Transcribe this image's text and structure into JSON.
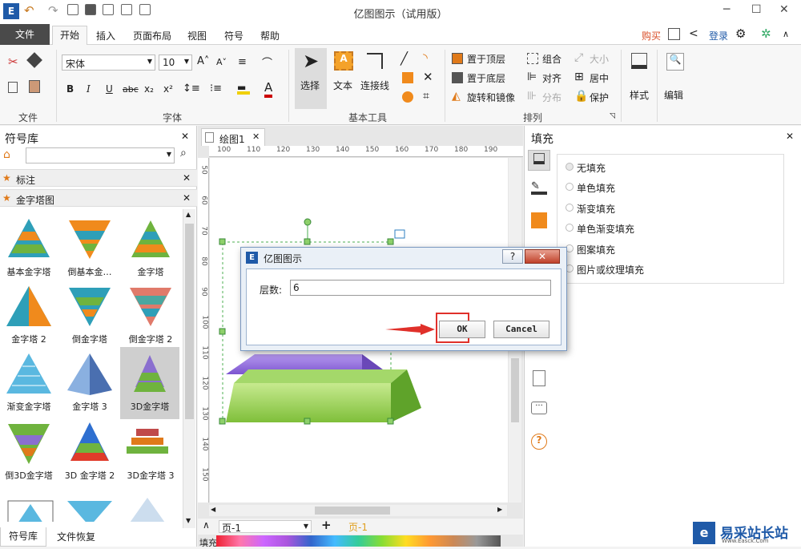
{
  "window": {
    "title": "亿图图示（试用版）",
    "min": "─",
    "max": "☐",
    "close": "✕"
  },
  "menu": {
    "file": "文件",
    "tabs": [
      "开始",
      "插入",
      "页面布局",
      "视图",
      "符号",
      "帮助"
    ],
    "buy": "购买",
    "login": "登录"
  },
  "ribbon": {
    "groups": {
      "file": "文件",
      "font": "字体",
      "basic_tools": "基本工具",
      "arrange": "排列"
    },
    "font_name": "宋体",
    "font_size": "10",
    "bold": "B",
    "italic": "I",
    "underline": "U",
    "strike": "abc",
    "subscript": "x₂",
    "superscript": "x²",
    "select": "选择",
    "text": "文本",
    "connector": "连接线",
    "bring_front": "置于顶层",
    "send_back": "置于底层",
    "rotate_mirror": "旋转和镜像",
    "group": "组合",
    "align": "对齐",
    "distribute": "分布",
    "size": "大小",
    "center": "居中",
    "protect": "保护",
    "style": "样式",
    "edit": "编辑"
  },
  "left": {
    "title": "符号库",
    "close": "✕",
    "lib_marked": "标注",
    "lib_pyramid": "金字塔图",
    "shapes": [
      "基本金字塔",
      "倒基本金…",
      "金字塔",
      "金字塔 2",
      "倒金字塔",
      "倒金字塔 2",
      "渐变金字塔",
      "金字塔 3",
      "3D金字塔",
      "倒3D金字塔",
      "3D 金字塔 2",
      "3D金字塔 3"
    ],
    "tab_lib": "符号库",
    "tab_recover": "文件恢复"
  },
  "canvas": {
    "doc_tab": "绘图1",
    "doc_close": "✕",
    "ruler_top": [
      "100",
      "110",
      "120",
      "130",
      "140",
      "150",
      "160",
      "170",
      "180",
      "190"
    ],
    "ruler_left": [
      "50",
      "60",
      "70",
      "80",
      "90",
      "100",
      "110",
      "120",
      "130",
      "140",
      "150"
    ],
    "page_name": "页-1",
    "page_tab": "页-1",
    "add": "+",
    "fill_label": "填充"
  },
  "fill": {
    "title": "填充",
    "close": "✕",
    "options": [
      "无填充",
      "单色填充",
      "渐变填充",
      "单色渐变填充",
      "图案填充",
      "图片或纹理填充"
    ]
  },
  "dialog": {
    "title": "亿图图示",
    "help": "?",
    "close": "✕",
    "label": "层数:",
    "value": "6",
    "ok": "OK",
    "cancel": "Cancel"
  },
  "watermark": {
    "text": "易采站长站",
    "sub": "Www.Easck.Com"
  },
  "colors": {
    "accent": "#d94f2a",
    "dialog_border": "#7a98c0",
    "highlight": "#e0302a"
  }
}
